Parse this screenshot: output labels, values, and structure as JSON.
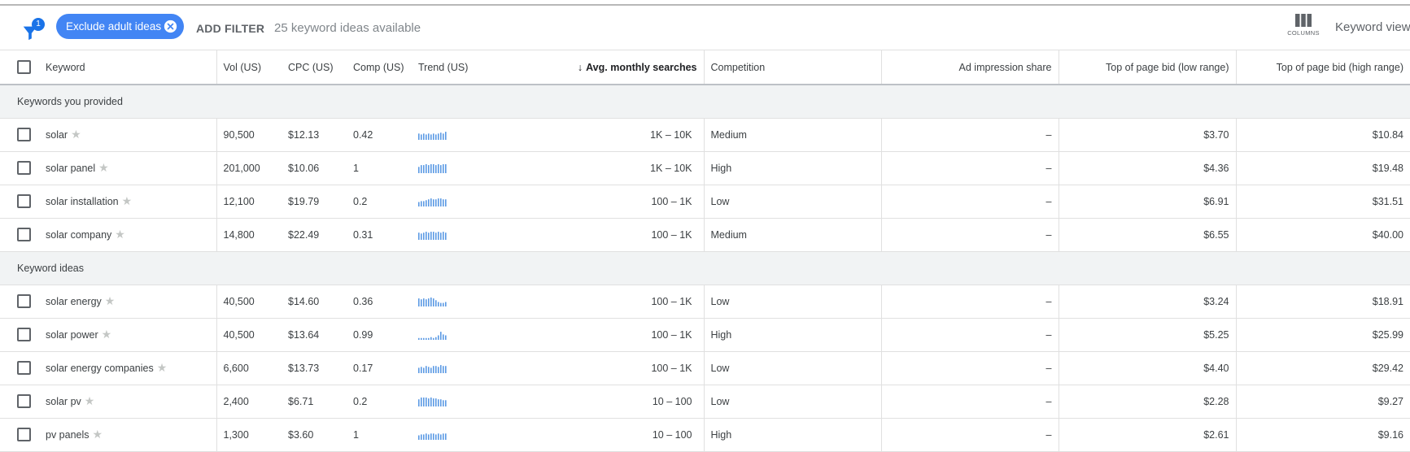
{
  "toolbar": {
    "filter_badge": "1",
    "chip_label": "Exclude adult ideas",
    "add_filter": "ADD FILTER",
    "available": "25 keyword ideas available",
    "columns_label": "COLUMNS",
    "keyword_view": "Keyword view"
  },
  "headers": {
    "keyword": "Keyword",
    "vol": "Vol (US)",
    "cpc": "CPC (US)",
    "comp": "Comp (US)",
    "trend": "Trend (US)",
    "avg": "Avg. monthly searches",
    "competition": "Competition",
    "ad_share": "Ad impression share",
    "bid_low": "Top of page bid (low range)",
    "bid_high": "Top of page bid (high range)"
  },
  "groups": {
    "provided": "Keywords you provided",
    "ideas": "Keyword ideas"
  },
  "rows": [
    {
      "keyword": "solar",
      "vol": "90,500",
      "cpc": "$12.13",
      "comp": "0.42",
      "avg": "1K – 10K",
      "competition": "Medium",
      "ad_share": "–",
      "bid_low": "$3.70",
      "bid_high": "$10.84",
      "trend": [
        7,
        6,
        7,
        6,
        7,
        6,
        7,
        6,
        7,
        8,
        7,
        9
      ]
    },
    {
      "keyword": "solar panel",
      "vol": "201,000",
      "cpc": "$10.06",
      "comp": "1",
      "avg": "1K – 10K",
      "competition": "High",
      "ad_share": "–",
      "bid_low": "$4.36",
      "bid_high": "$19.48",
      "trend": [
        7,
        9,
        9,
        10,
        9,
        10,
        10,
        9,
        10,
        9,
        10,
        10
      ]
    },
    {
      "keyword": "solar installation",
      "vol": "12,100",
      "cpc": "$19.79",
      "comp": "0.2",
      "avg": "100 – 1K",
      "competition": "Low",
      "ad_share": "–",
      "bid_low": "$6.91",
      "bid_high": "$31.51",
      "trend": [
        5,
        6,
        6,
        7,
        8,
        9,
        8,
        8,
        9,
        9,
        8,
        8
      ]
    },
    {
      "keyword": "solar company",
      "vol": "14,800",
      "cpc": "$22.49",
      "comp": "0.31",
      "avg": "100 – 1K",
      "competition": "Medium",
      "ad_share": "–",
      "bid_low": "$6.55",
      "bid_high": "$40.00",
      "trend": [
        8,
        7,
        8,
        9,
        8,
        9,
        9,
        8,
        9,
        8,
        9,
        8
      ]
    },
    {
      "keyword": "solar energy",
      "vol": "40,500",
      "cpc": "$14.60",
      "comp": "0.36",
      "avg": "100 – 1K",
      "competition": "Low",
      "ad_share": "–",
      "bid_low": "$3.24",
      "bid_high": "$18.91",
      "trend": [
        9,
        8,
        9,
        8,
        9,
        10,
        9,
        7,
        5,
        4,
        4,
        5
      ]
    },
    {
      "keyword": "solar power",
      "vol": "40,500",
      "cpc": "$13.64",
      "comp": "0.99",
      "avg": "100 – 1K",
      "competition": "High",
      "ad_share": "–",
      "bid_low": "$5.25",
      "bid_high": "$25.99",
      "trend": [
        2,
        2,
        2,
        2,
        2,
        3,
        2,
        3,
        5,
        9,
        6,
        5
      ]
    },
    {
      "keyword": "solar energy companies",
      "vol": "6,600",
      "cpc": "$13.73",
      "comp": "0.17",
      "avg": "100 – 1K",
      "competition": "Low",
      "ad_share": "–",
      "bid_low": "$4.40",
      "bid_high": "$29.42",
      "trend": [
        6,
        7,
        6,
        8,
        7,
        6,
        8,
        8,
        7,
        9,
        8,
        8
      ]
    },
    {
      "keyword": "solar pv",
      "vol": "2,400",
      "cpc": "$6.71",
      "comp": "0.2",
      "avg": "10 – 100",
      "competition": "Low",
      "ad_share": "–",
      "bid_low": "$2.28",
      "bid_high": "$9.27",
      "trend": [
        8,
        10,
        10,
        10,
        9,
        10,
        9,
        9,
        8,
        8,
        7,
        7
      ]
    },
    {
      "keyword": "pv panels",
      "vol": "1,300",
      "cpc": "$3.60",
      "comp": "1",
      "avg": "10 – 100",
      "competition": "High",
      "ad_share": "–",
      "bid_low": "$2.61",
      "bid_high": "$9.16",
      "trend": [
        5,
        6,
        6,
        7,
        6,
        7,
        7,
        6,
        7,
        6,
        7,
        7
      ]
    }
  ],
  "colors": {
    "accent": "#4285f4",
    "trend": "#5b9ae4"
  }
}
